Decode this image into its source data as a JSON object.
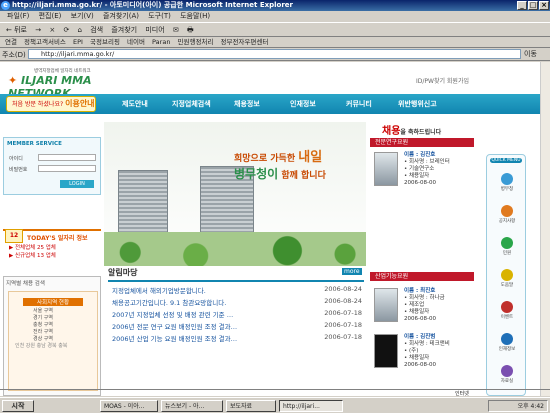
{
  "window": {
    "title": "http://iljari.mma.go.kr/ - 아토미디어(아이) 공급한 Microsoft Internet Explorer",
    "buttons": [
      "_",
      "□",
      "×"
    ]
  },
  "menu": [
    "파일(F)",
    "편집(E)",
    "보기(V)",
    "즐겨찾기(A)",
    "도구(T)",
    "도움말(H)"
  ],
  "toolbar": [
    "← 뒤로",
    "→",
    "×",
    "⟳",
    "⌂",
    "검색",
    "즐겨찾기",
    "미디어",
    "✉",
    "🖶"
  ],
  "links_label": "연결",
  "links": [
    "정책고객서비스",
    "EPI",
    "국정브리핑",
    "네이버",
    "Paran",
    "민원행정처리",
    "정부전자우편센터"
  ],
  "address": {
    "label": "주소(D)",
    "url": "http://iljari.mma.go.kr/",
    "go": "이동"
  },
  "site": {
    "logo_text": "ILJARI MMA NETWORK",
    "logo_sub": "병역지정업체 일자리 네트워크",
    "top_links": "ID/PW찾기 회원가입",
    "guide_small": "처음 방문 하셨나요?",
    "guide_big": "이용안내",
    "nav": [
      "제도안내",
      "지정업체검색",
      "채용정보",
      "인재정보",
      "커뮤니티",
      "위반행위신고"
    ],
    "member": {
      "title": "MEMBER SERVICE",
      "id_label": "아이디",
      "pw_label": "비밀번호",
      "login": "LOGIN"
    },
    "today": {
      "cal": "12",
      "title": "TODAY'S 일자리 정보",
      "rows": [
        "▶ 전체업체 25 업체",
        "▶ 신규업체 13 업체"
      ]
    },
    "map": {
      "title": "지역별 채용 검색",
      "heading": "사회지역 현황",
      "rows": [
        "서울 구역",
        "경기 구역",
        "충청 구역",
        "전라 구역",
        "경상 구역"
      ],
      "labels": [
        "인천",
        "강원",
        "충남",
        "경북",
        "충북"
      ]
    },
    "hero": {
      "slogan_line1": "희망으로 가득한",
      "slogan_big": "내일",
      "slogan_line2": "병무청이",
      "slogan_line3": "함께 합니다"
    },
    "notice": {
      "title": "알림마당",
      "more": "more",
      "items": [
        {
          "text": "지정업체에서 해외기업방문합니다.",
          "date": "2006-08-24"
        },
        {
          "text": "채용공고기간입니다. 9.1 참관요망합니다.",
          "date": "2006-08-24"
        },
        {
          "text": "2007년 지정업체 선정 및 배정 관련 기준 …",
          "date": "2006-07-18"
        },
        {
          "text": "2006년 전문 연구 요원 배정인원 조정 결과…",
          "date": "2006-07-18"
        },
        {
          "text": "2006년 산업 기능 요원 배정인원 조정 결과…",
          "date": "2006-07-18"
        }
      ]
    },
    "congrats": {
      "title": "채용",
      "suffix": "을 축하드립니다"
    },
    "sections": [
      {
        "title": "전문연구요원",
        "people": [
          {
            "name": "이름 : 김진호",
            "lines": [
              "• 회사명 : 브레인터",
              "• 기술연구소",
              "• 채용일자",
              "2006-08-00"
            ]
          }
        ]
      },
      {
        "title": "산업기능요원",
        "people": [
          {
            "name": "이름 : 최진호",
            "lines": [
              "• 회사명 : 하나금",
              "• 제조업",
              "• 채용일자",
              "2006-08-00"
            ]
          },
          {
            "name": "이름 : 김진범",
            "lines": [
              "• 회사명 : 테크앤비",
              "• (주)",
              "• 채용일자",
              "2006-08-00"
            ]
          }
        ]
      }
    ],
    "quick": {
      "title": "QUICK MENU",
      "items": [
        "병무청",
        "공지사항",
        "민원",
        "도움말",
        "이벤트",
        "인재정보",
        "자료실"
      ],
      "colors": [
        "#3a9bd5",
        "#e07a1f",
        "#2aa64a",
        "#d9b300",
        "#c0302c",
        "#1e6fb8",
        "#7a4fb0"
      ]
    }
  },
  "status": {
    "left": "",
    "zone": "인터넷"
  },
  "taskbar": {
    "start": "시작",
    "tasks": [
      "",
      "MOAS - 이아...",
      "뉴스보기 - 아...",
      "보도자료",
      "http://iljari...",
      "",
      ""
    ],
    "clock": "오후 4:42"
  }
}
